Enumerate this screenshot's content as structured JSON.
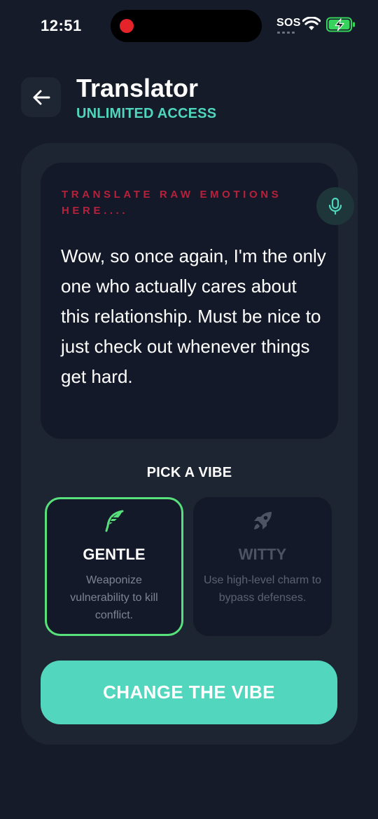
{
  "status_bar": {
    "time": "12:51",
    "carrier_text": "SOS",
    "battery_color": "#37d45d"
  },
  "header": {
    "title": "Translator",
    "subtitle": "UNLIMITED ACCESS",
    "back_icon": "arrow-left-icon"
  },
  "input": {
    "label": "TRANSLATE RAW EMOTIONS HERE....",
    "text": "Wow, so once again, I'm the only one who actually cares about this relationship. Must be nice to just check out whenever things get hard.",
    "mic_icon": "microphone-icon"
  },
  "vibe_picker": {
    "heading": "PICK A VIBE",
    "options": [
      {
        "name": "GENTLE",
        "description": "Weaponize vulnerability to kill conflict.",
        "icon": "feather-icon",
        "selected": true
      },
      {
        "name": "WITTY",
        "description": "Use high-level charm to bypass defenses.",
        "icon": "rocket-icon",
        "selected": false
      }
    ]
  },
  "cta": {
    "label": "CHANGE THE VIBE"
  },
  "colors": {
    "background": "#151b29",
    "card": "#1e2532",
    "accent": "#52d6be",
    "selected_border": "#58e07b",
    "label_red": "#b8203c"
  }
}
